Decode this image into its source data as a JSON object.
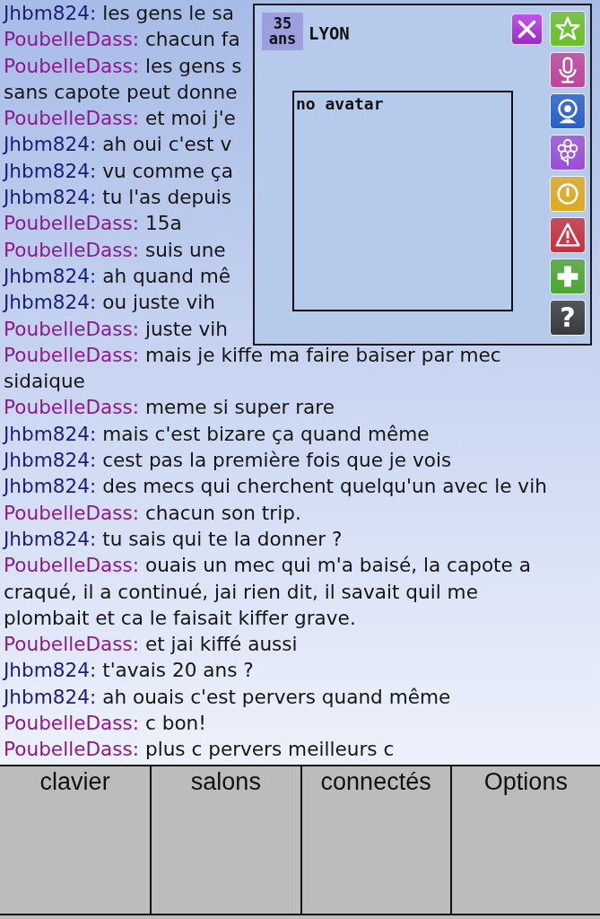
{
  "chat": {
    "messages": [
      {
        "user": "Jhbm824:",
        "color": "#1c1c78",
        "text": "les gens le sa"
      },
      {
        "user": "PoubelleDass:",
        "color": "#8a1a8e",
        "text": "chacun fa"
      },
      {
        "user": "PoubelleDass:",
        "color": "#8a1a8e",
        "text": "les gens s"
      },
      {
        "text": "sans capote peut donne"
      },
      {
        "user": "PoubelleDass:",
        "color": "#8a1a8e",
        "text": "et moi j'e"
      },
      {
        "user": "Jhbm824:",
        "color": "#1c1c78",
        "text": "ah oui c'est v"
      },
      {
        "user": "Jhbm824:",
        "color": "#1c1c78",
        "text": "vu comme ça"
      },
      {
        "user": "Jhbm824:",
        "color": "#1c1c78",
        "text": "tu l'as depuis"
      },
      {
        "user": "PoubelleDass:",
        "color": "#8a1a8e",
        "text": "15a"
      },
      {
        "user": "PoubelleDass:",
        "color": "#8a1a8e",
        "text": "suis une"
      },
      {
        "user": "Jhbm824:",
        "color": "#1c1c78",
        "text": "ah quand mê"
      },
      {
        "user": "Jhbm824:",
        "color": "#1c1c78",
        "text": "ou juste vih"
      },
      {
        "user": "PoubelleDass:",
        "color": "#8a1a8e",
        "text": "juste vih"
      },
      {
        "user": "PoubelleDass:",
        "color": "#8a1a8e",
        "text": "mais je kiffe ma faire baiser par mec sidaique"
      },
      {
        "user": "PoubelleDass:",
        "color": "#8a1a8e",
        "text": "meme si super rare"
      },
      {
        "user": "Jhbm824:",
        "color": "#1c1c78",
        "text": "mais c'est bizare ça quand même"
      },
      {
        "user": "Jhbm824:",
        "color": "#1c1c78",
        "text": "cest pas la première fois que je vois"
      },
      {
        "user": "Jhbm824:",
        "color": "#1c1c78",
        "text": "des mecs qui cherchent quelqu'un avec le vih"
      },
      {
        "user": "PoubelleDass:",
        "color": "#8a1a8e",
        "text": "chacun son trip."
      },
      {
        "user": "Jhbm824:",
        "color": "#1c1c78",
        "text": "tu sais qui te la donner ?"
      },
      {
        "user": "PoubelleDass:",
        "color": "#8a1a8e",
        "text": "ouais un mec qui m'a baisé, la capote a craqué, il a continué, jai rien dit, il savait quil me plombait et ca le faisait kiffer grave."
      },
      {
        "user": "PoubelleDass:",
        "color": "#8a1a8e",
        "text": "et jai kiffé aussi"
      },
      {
        "user": "Jhbm824:",
        "color": "#1c1c78",
        "text": "t'avais 20 ans ?"
      },
      {
        "user": "Jhbm824:",
        "color": "#1c1c78",
        "text": "ah ouais c'est pervers quand même"
      },
      {
        "user": "PoubelleDass:",
        "color": "#8a1a8e",
        "text": "c bon!"
      },
      {
        "user": "PoubelleDass:",
        "color": "#8a1a8e",
        "text": "plus c pervers meilleurs c"
      }
    ]
  },
  "profile_popup": {
    "age": "35",
    "age_unit": "ans",
    "city": "LYON",
    "avatar_text": "no avatar",
    "actions": [
      {
        "kind": "favorite",
        "color": "#6cbf2a"
      },
      {
        "kind": "voice",
        "color": "#c0439a"
      },
      {
        "kind": "webcam",
        "color": "#2a5fc8"
      },
      {
        "kind": "gift",
        "color": "#9a4fd6"
      },
      {
        "kind": "info",
        "color": "#e0a91e"
      },
      {
        "kind": "report",
        "color": "#c8303a"
      },
      {
        "kind": "add",
        "color": "#4fa630"
      },
      {
        "kind": "help",
        "color": "#3a3a3a",
        "label": "?"
      }
    ]
  },
  "bottom_tabs": [
    {
      "label": "clavier"
    },
    {
      "label": "salons"
    },
    {
      "label": "connectés"
    },
    {
      "label": "Options"
    }
  ]
}
